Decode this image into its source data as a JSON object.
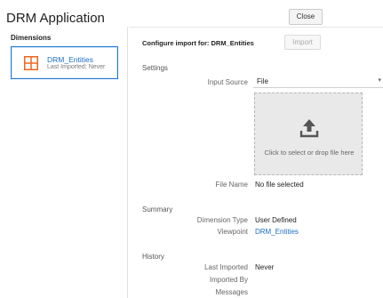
{
  "app": {
    "title": "DRM Application",
    "close_label": "Close"
  },
  "sidebar": {
    "heading": "Dimensions",
    "items": [
      {
        "name": "DRM_Entities",
        "subtitle": "Last Imported: Never",
        "icon": "grid-icon",
        "selected": true
      }
    ]
  },
  "main": {
    "configure_title": "Configure import for: DRM_Entities",
    "import_label": "Import",
    "settings": {
      "heading": "Settings",
      "input_source_label": "Input Source",
      "input_source_value": "File",
      "dropzone_text": "Click to select or drop file here",
      "file_name_label": "File Name",
      "file_name_value": "No file selected"
    },
    "summary": {
      "heading": "Summary",
      "dimension_type_label": "Dimension Type",
      "dimension_type_value": "User Defined",
      "viewpoint_label": "Viewpoint",
      "viewpoint_value": "DRM_Entities"
    },
    "history": {
      "heading": "History",
      "last_imported_label": "Last Imported",
      "last_imported_value": "Never",
      "imported_by_label": "Imported By",
      "imported_by_value": "",
      "messages_label": "Messages"
    }
  },
  "colors": {
    "accent": "#1b6fc7",
    "icon_orange": "#f0651f",
    "dropzone_bg": "#e9e9e9"
  }
}
